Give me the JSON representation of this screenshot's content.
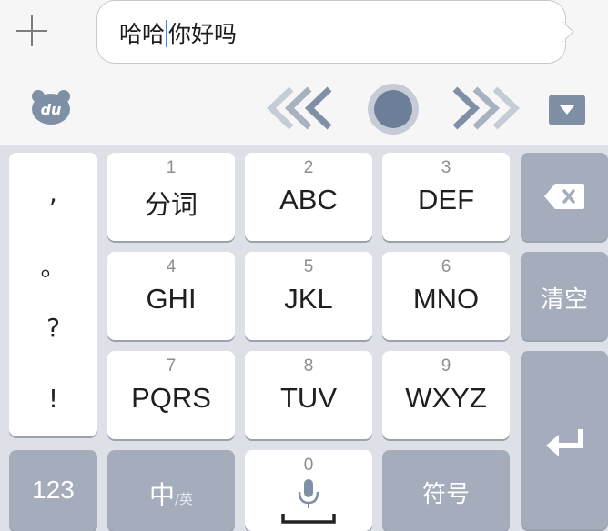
{
  "message": {
    "text_before_caret": "哈哈",
    "text_after_caret": "你好吗"
  },
  "toolbar": {
    "logo_text": "du",
    "icons": [
      "plus-icon",
      "du-bear-logo",
      "left-arrows-icon",
      "circle-dot-icon",
      "right-arrows-icon",
      "collapse-triangle-icon"
    ]
  },
  "keyboard": {
    "punctuation": [
      ",",
      "。",
      "?",
      "!"
    ],
    "rows": [
      [
        {
          "num": "1",
          "label": "分词"
        },
        {
          "num": "2",
          "label": "ABC"
        },
        {
          "num": "3",
          "label": "DEF"
        }
      ],
      [
        {
          "num": "4",
          "label": "GHI"
        },
        {
          "num": "5",
          "label": "JKL"
        },
        {
          "num": "6",
          "label": "MNO"
        }
      ],
      [
        {
          "num": "7",
          "label": "PQRS"
        },
        {
          "num": "8",
          "label": "TUV"
        },
        {
          "num": "9",
          "label": "WXYZ"
        }
      ]
    ],
    "clear_label": "清空",
    "numbers_label": "123",
    "lang_main": "中",
    "lang_alt": "/英",
    "space_num": "0",
    "symbols_label": "符号"
  },
  "colors": {
    "key_white": "#ffffff",
    "key_gray": "#a5acbb",
    "keyboard_bg": "#dde0e6",
    "toolbar_icon": "#7f8fa6",
    "caret": "#3b8be0"
  }
}
